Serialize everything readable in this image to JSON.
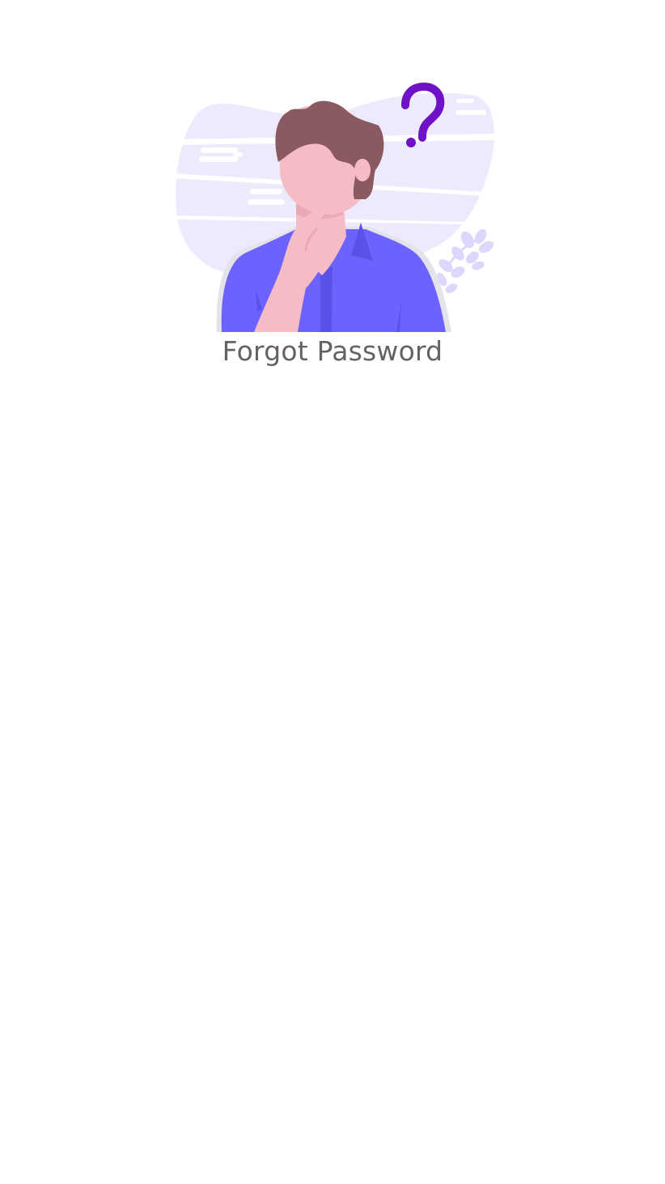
{
  "screen": {
    "title": "Forgot Password",
    "illustration_icon": "confused-person-question-mark-illustration"
  },
  "colors": {
    "background": "#ffffff",
    "title_text": "#636363",
    "blob": "#eceafc",
    "shirt": "#6c63ff",
    "shirt_shadow": "#5a52e8",
    "skin": "#f6bcc6",
    "skin_shadow": "#eaa9b5",
    "hair": "#8a5a60",
    "question_mark": "#6f11c7",
    "leaves": "#dcd8fb"
  }
}
